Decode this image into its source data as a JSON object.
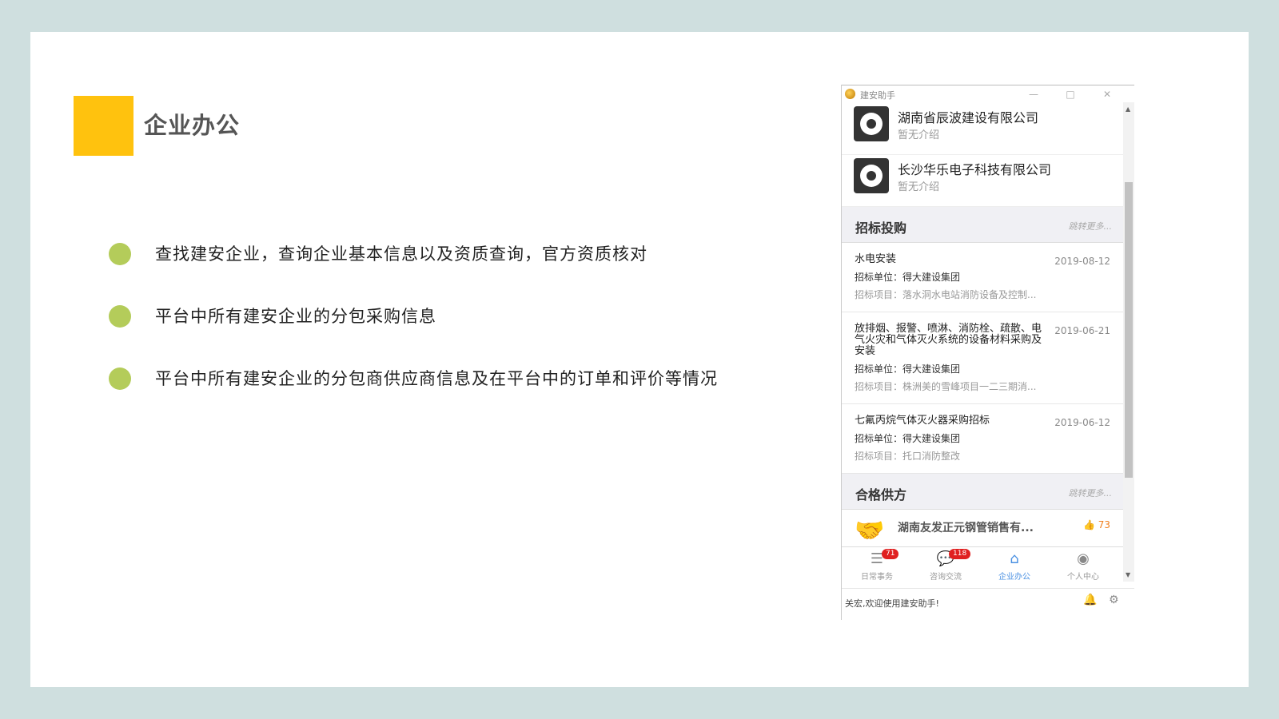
{
  "slide": {
    "title": "企业办公",
    "bullets": [
      "查找建安企业，查询企业基本信息以及资质查询，官方资质核对",
      "平台中所有建安企业的分包采购信息",
      "平台中所有建安企业的分包商供应商信息及在平台中的订单和评价等情况"
    ],
    "colors": {
      "accent": "#ffc20e",
      "bullet": "#b4cc5a",
      "background": "#cfdfdf"
    }
  },
  "app": {
    "window_title": "建安助手",
    "window_buttons": {
      "minimize": "—",
      "maximize": "□",
      "close": "✕"
    },
    "companies": [
      {
        "name": "湖南省辰波建设有限公司",
        "desc": "暂无介绍"
      },
      {
        "name": "长沙华乐电子科技有限公司",
        "desc": "暂无介绍"
      }
    ],
    "bidding": {
      "title": "招标投购",
      "more": "跳转更多...",
      "items": [
        {
          "title": "水电安装",
          "date": "2019-08-12",
          "unit": "招标单位：得大建设集团",
          "project": "招标项目：落水洞水电站消防设备及控制..."
        },
        {
          "title": "放排烟、报警、喷淋、消防栓、疏散、电气火灾和气体灭火系统的设备材料采购及安装",
          "date": "2019-06-21",
          "unit": "招标单位：得大建设集团",
          "project": "招标项目：株洲美的雪峰项目一二三期消..."
        },
        {
          "title": "七氟丙烷气体灭火器采购招标",
          "date": "2019-06-12",
          "unit": "招标单位：得大建设集团",
          "project": "招标项目：托口消防整改"
        }
      ]
    },
    "suppliers": {
      "title": "合格供方",
      "more": "跳转更多...",
      "items": [
        {
          "name": "湖南友发正元钢管销售有...",
          "likes": "73"
        }
      ]
    },
    "tabs": [
      {
        "label": "日常事务",
        "badge": "71",
        "icon": "menu-icon"
      },
      {
        "label": "咨询交流",
        "badge": "118",
        "icon": "chat-icon"
      },
      {
        "label": "企业办公",
        "badge": "",
        "icon": "home-icon"
      },
      {
        "label": "个人中心",
        "badge": "",
        "icon": "user-icon"
      }
    ],
    "status": "关宏,欢迎使用建安助手!",
    "colors": {
      "tab_active": "#4a90e2",
      "badge": "#e02020"
    }
  }
}
